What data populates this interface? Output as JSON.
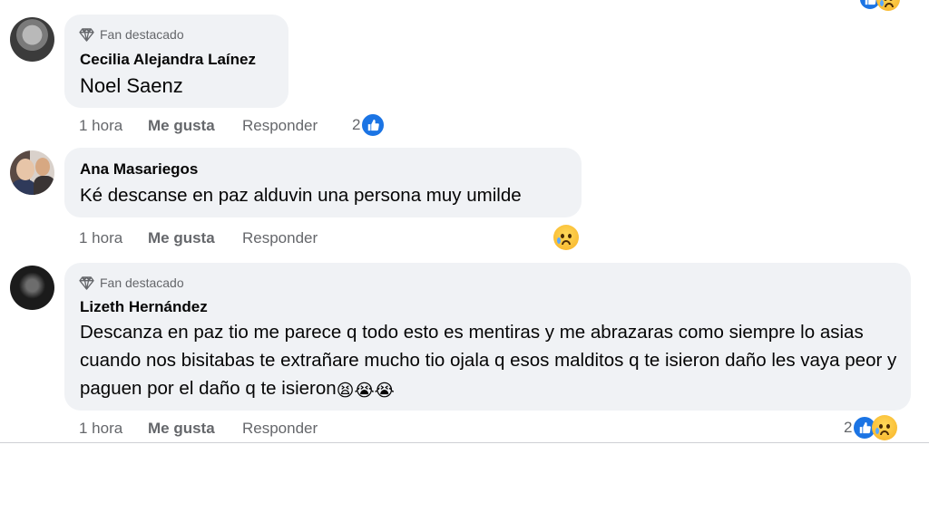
{
  "comments": [
    {
      "badge": "Fan destacado",
      "author": "Cecilia Alejandra Laínez",
      "text": "Noel Saenz",
      "time": "1 hora",
      "like_label": "Me gusta",
      "reply_label": "Responder",
      "reaction_count": "2"
    },
    {
      "author": "Ana Masariegos",
      "text": "Ké descanse en paz alduvin una persona muy umilde",
      "time": "1 hora",
      "like_label": "Me gusta",
      "reply_label": "Responder"
    },
    {
      "badge": "Fan destacado",
      "author": "Lizeth Hernández",
      "text": "Descanza en paz tio me parece q todo esto es mentiras y me abrazaras como siempre lo asias cuando nos bisitabas te extrañare mucho tio ojala q esos malditos q te isieron daño les vaya peor y paguen por el daño q te isieron",
      "emoji_suffix": "😫😭😭",
      "time": "1 hora",
      "like_label": "Me gusta",
      "reply_label": "Responder",
      "reaction_count": "2"
    }
  ],
  "colors": {
    "bubble_bg": "#f0f2f5",
    "like_blue": "#1b74e4",
    "secondary_text": "#65676b"
  }
}
